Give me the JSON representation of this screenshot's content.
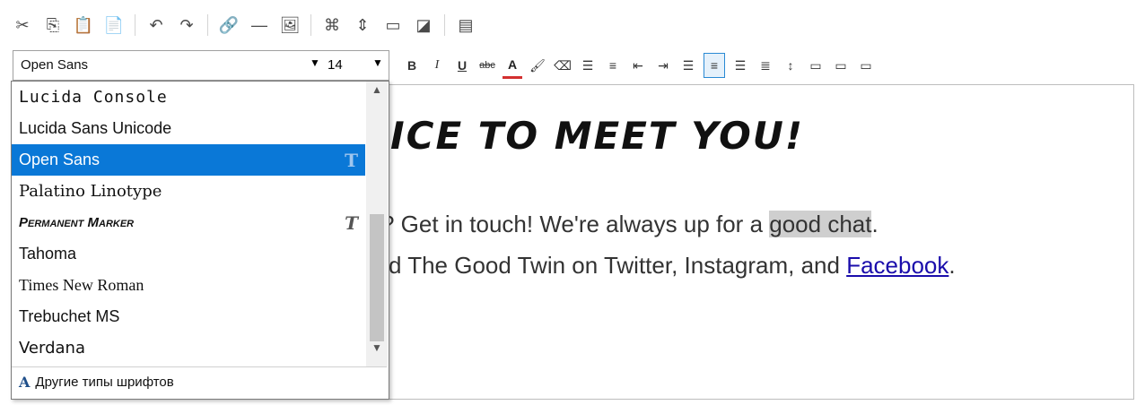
{
  "toolbar": {
    "row1_icons": [
      "cut-icon",
      "copy-icon",
      "paste-icon",
      "paste-text-icon",
      "undo-icon",
      "redo-icon",
      "link-icon",
      "horizontal-rule-icon",
      "image-icon",
      "html-source-icon",
      "block-format-icon",
      "page-break-icon",
      "contrast-icon",
      "template-icon"
    ],
    "font_name": "Open Sans",
    "font_size": "14",
    "format_labels": {
      "bold": "B",
      "italic": "I",
      "underline": "U",
      "strike": "abc",
      "font_color": "A"
    }
  },
  "editor": {
    "heading_visible": "ICE TO MEET YOU!",
    "line1_before": "? Get in touch! We're always up for a ",
    "line1_highlight": "good chat",
    "line1_after": ".",
    "line2_before": "d The Good Twin on Twitter, Instagram, and ",
    "line2_link": "Facebook",
    "line2_after": "."
  },
  "font_dropdown": {
    "items": [
      {
        "label": "Lucida Console",
        "truetype": false
      },
      {
        "label": "Lucida Sans Unicode",
        "truetype": false
      },
      {
        "label": "Open Sans",
        "truetype": true,
        "selected": true
      },
      {
        "label": "Palatino Linotype",
        "truetype": false
      },
      {
        "label": "Permanent Marker",
        "truetype": true
      },
      {
        "label": "Tahoma",
        "truetype": false
      },
      {
        "label": "Times New Roman",
        "truetype": false
      },
      {
        "label": "Trebuchet MS",
        "truetype": false
      },
      {
        "label": "Verdana",
        "truetype": false
      }
    ],
    "more_fonts_label": "Другие типы шрифтов",
    "truetype_glyph": "T",
    "more_icon_glyph": "A"
  },
  "colors": {
    "selection": "#0a78d7",
    "highlight": "#cfcfcf",
    "link": "#1a0dab"
  }
}
